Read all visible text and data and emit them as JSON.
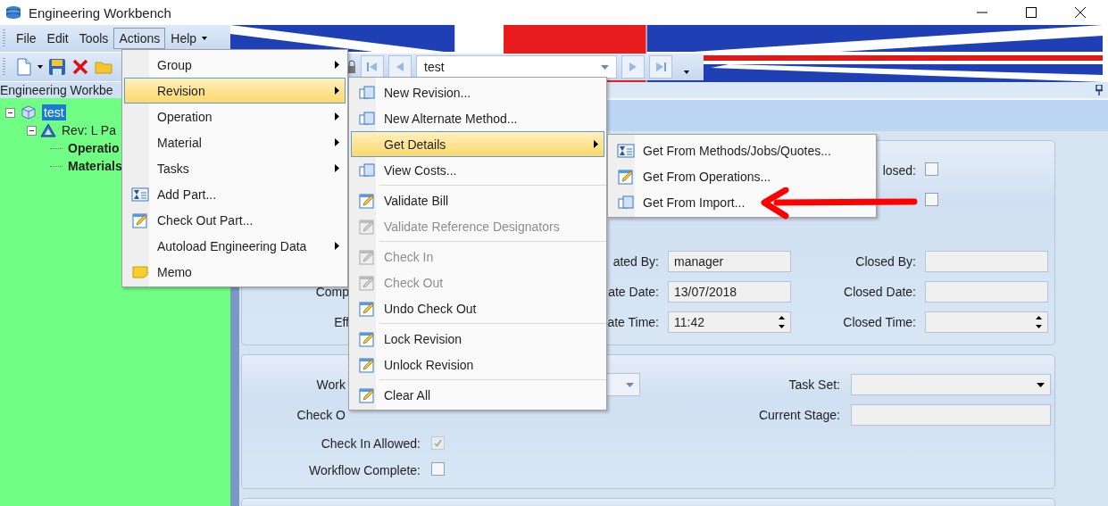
{
  "window": {
    "title": "Engineering Workbench"
  },
  "menu_bar": [
    {
      "label": "File",
      "selected": false
    },
    {
      "label": "Edit",
      "selected": false
    },
    {
      "label": "Tools",
      "selected": false
    },
    {
      "label": "Actions",
      "selected": true
    },
    {
      "label": "Help",
      "selected": false
    }
  ],
  "navigator": {
    "value": "test"
  },
  "tree_panel": {
    "title": "Engineering Workbe",
    "tree": [
      {
        "label": "test",
        "kind": "part",
        "selected": true,
        "expanded": true,
        "children": [
          {
            "label": "Rev: L Pa",
            "kind": "revision",
            "selected": false,
            "expanded": true,
            "children": [
              {
                "label": "Operatio",
                "kind": "leaf",
                "selected": false
              },
              {
                "label": "Materials",
                "kind": "leaf",
                "selected": false
              }
            ]
          }
        ]
      }
    ]
  },
  "revision_form": {
    "left_labels": [
      "Comp",
      "Eff"
    ],
    "closed": {
      "label": "losed:",
      "checked": false
    },
    "user": {
      "checked": false
    },
    "created_by": {
      "label": "ated By:",
      "value": "manager"
    },
    "create_date": {
      "label": "ate Date:",
      "value": "13/07/2018"
    },
    "create_time": {
      "label": "ate Time:",
      "value": "11:42"
    },
    "closed_by": {
      "label": "Closed By:"
    },
    "closed_date": {
      "label": "Closed Date:"
    },
    "closed_time": {
      "label": "Closed Time:"
    }
  },
  "workflow_form": {
    "workflow_label": "Work",
    "check_out_label": "Check O",
    "check_in_allowed": {
      "label": "Check In Allowed:",
      "checked": true,
      "disabled": true
    },
    "workflow_complete": {
      "label": "Workflow Complete:",
      "checked": false,
      "disabled": false
    },
    "task_set": {
      "label": "Task Set:"
    },
    "current_stage": {
      "label": "Current Stage:"
    }
  },
  "actions_menu": [
    {
      "label": "Group",
      "kind": "submenu",
      "selected": false
    },
    {
      "label": "Revision",
      "kind": "submenu",
      "selected": true
    },
    {
      "label": "Operation",
      "kind": "submenu",
      "selected": false
    },
    {
      "label": "Material",
      "kind": "submenu",
      "selected": false
    },
    {
      "label": "Tasks",
      "kind": "submenu",
      "selected": false
    },
    {
      "label": "Add Part...",
      "kind": "lookup",
      "selected": false
    },
    {
      "label": "Check Out Part...",
      "kind": "edit",
      "selected": false
    },
    {
      "label": "Autoload Engineering Data",
      "kind": "submenu",
      "selected": false
    },
    {
      "label": "Memo",
      "kind": "memo",
      "selected": false
    }
  ],
  "revision_menu": [
    {
      "label": "New Revision...",
      "kind": "dialog",
      "selected": false,
      "disabled": false
    },
    {
      "label": "New Alternate Method...",
      "kind": "dialog",
      "selected": false,
      "disabled": false
    },
    {
      "label": "Get Details",
      "kind": "submenu",
      "selected": true,
      "disabled": false
    },
    {
      "label": "View Costs...",
      "kind": "dialog",
      "selected": false,
      "disabled": false
    },
    {
      "kind": "separator"
    },
    {
      "label": "Validate Bill",
      "kind": "edit",
      "selected": false,
      "disabled": false
    },
    {
      "label": "Validate Reference Designators",
      "kind": "edit",
      "selected": false,
      "disabled": true
    },
    {
      "kind": "separator"
    },
    {
      "label": "Check In",
      "kind": "edit",
      "selected": false,
      "disabled": true
    },
    {
      "label": "Check Out",
      "kind": "edit",
      "selected": false,
      "disabled": true
    },
    {
      "label": "Undo Check Out",
      "kind": "edit",
      "selected": false,
      "disabled": false
    },
    {
      "kind": "separator"
    },
    {
      "label": "Lock Revision",
      "kind": "edit",
      "selected": false,
      "disabled": false
    },
    {
      "label": "Unlock Revision",
      "kind": "edit",
      "selected": false,
      "disabled": false
    },
    {
      "kind": "separator"
    },
    {
      "label": "Clear All",
      "kind": "edit",
      "selected": false,
      "disabled": false
    }
  ],
  "details_menu": [
    {
      "label": "Get From Methods/Jobs/Quotes...",
      "kind": "lookup",
      "selected": false
    },
    {
      "label": "Get From Operations...",
      "kind": "edit",
      "selected": false
    },
    {
      "label": "Get From Import...",
      "kind": "dialog",
      "selected": false
    }
  ]
}
